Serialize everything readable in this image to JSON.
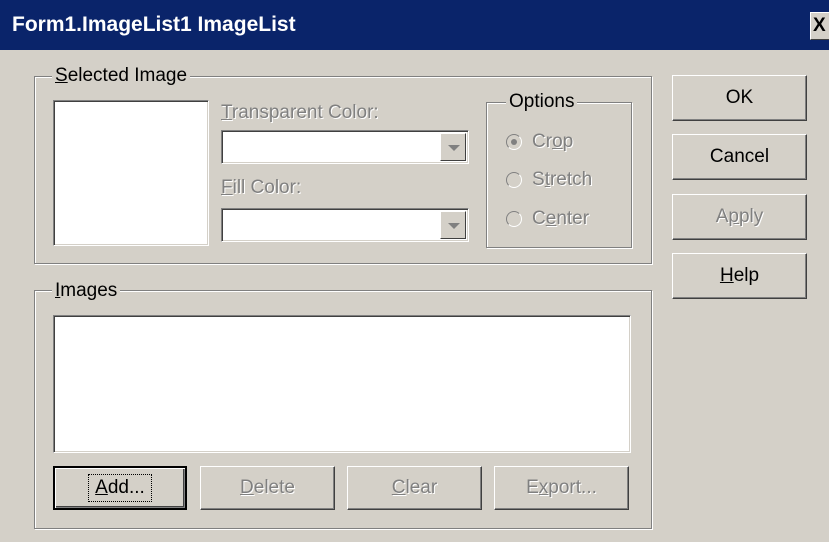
{
  "window": {
    "title": "Form1.ImageList1 ImageList",
    "close_label": "X"
  },
  "selected_image": {
    "label": "Selected Image",
    "transparent_color": {
      "label": "Transparent Color:",
      "value": ""
    },
    "fill_color": {
      "label": "Fill Color:",
      "value": ""
    },
    "options": {
      "label": "Options",
      "items": [
        {
          "label": "Crop",
          "checked": true,
          "enabled": false
        },
        {
          "label": "Stretch",
          "checked": false,
          "enabled": false
        },
        {
          "label": "Center",
          "checked": false,
          "enabled": false
        }
      ]
    }
  },
  "images": {
    "label": "Images",
    "buttons": {
      "add": "Add...",
      "delete": "Delete",
      "clear": "Clear",
      "export": "Export..."
    }
  },
  "side_buttons": {
    "ok": "OK",
    "cancel": "Cancel",
    "apply": "Apply",
    "help": "Help"
  },
  "colors": {
    "face": "#d4d0c8",
    "titlebar": "#0a246a",
    "disabled_text": "#808080"
  }
}
